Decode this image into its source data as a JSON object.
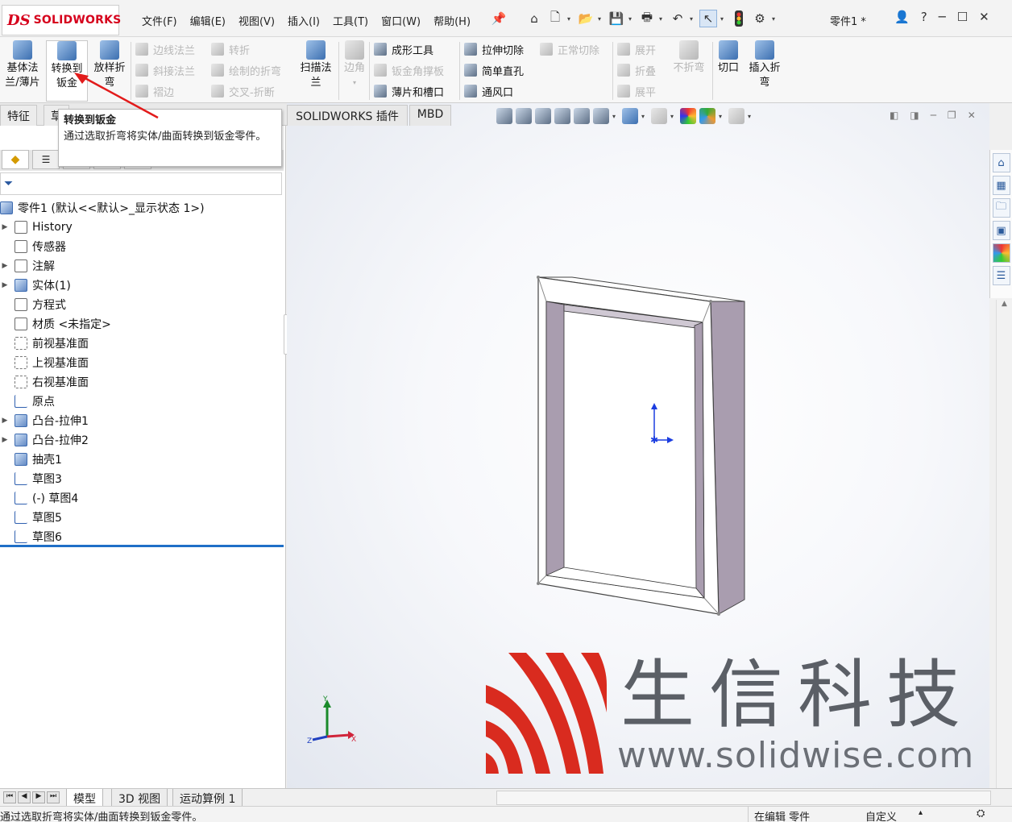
{
  "app": {
    "logo_ds": "DS",
    "logo_text": "SOLIDWORKS",
    "doc_title": "零件1 *"
  },
  "menu": [
    "文件(F)",
    "编辑(E)",
    "视图(V)",
    "插入(I)",
    "工具(T)",
    "窗口(W)",
    "帮助(H)"
  ],
  "ribbon": {
    "base_flange": "基体法兰/薄片",
    "convert_to_sheet_metal": "转换到钣金",
    "lofted_bend": "放样折弯",
    "edge_flange": "边线法兰",
    "miter_flange": "斜接法兰",
    "hem": "褶边",
    "jog": "转折",
    "sketched_bend": "绘制的折弯",
    "cross_break": "交叉-折断",
    "swept_flange": "扫描法兰",
    "corners": "边角",
    "forming_tool": "成形工具",
    "gusset": "钣金角撑板",
    "tab_slot": "薄片和槽口",
    "extruded_cut": "拉伸切除",
    "simple_hole": "简单直孔",
    "vent": "通风口",
    "normal_cut": "正常切除",
    "unfold": "展开",
    "fold": "折叠",
    "flatten": "展平",
    "no_bends": "不折弯",
    "rip": "切口",
    "insert_bends": "插入折弯"
  },
  "tabs": [
    "特征",
    "草",
    "SOLIDWORKS 插件",
    "MBD"
  ],
  "tooltip": {
    "title": "转换到钣金",
    "description": "通过选取折弯将实体/曲面转换到钣金零件。"
  },
  "tree": {
    "root": "零件1 (默认<<默认>_显示状态 1>)",
    "items": [
      "History",
      "传感器",
      "注解",
      "实体(1)",
      "方程式",
      "材质 <未指定>",
      "前视基准面",
      "上视基准面",
      "右视基准面",
      "原点",
      "凸台-拉伸1",
      "凸台-拉伸2",
      "抽壳1",
      "草图3",
      "(-) 草图4",
      "草图5",
      "草图6"
    ]
  },
  "triad": {
    "x": "X",
    "y": "Y",
    "z": "Z"
  },
  "watermark": {
    "cn": "生信科技",
    "url": "www.solidwise.com"
  },
  "bottom_tabs": [
    "模型",
    "3D 视图",
    "运动算例 1"
  ],
  "status": {
    "message": "通过选取折弯将实体/曲面转换到钣金零件。",
    "mode": "在编辑 零件",
    "custom": "自定义"
  },
  "colors": {
    "accent_red": "#d6001c",
    "selection_blue": "#1f6fc7",
    "model_side": "#a99daf"
  }
}
